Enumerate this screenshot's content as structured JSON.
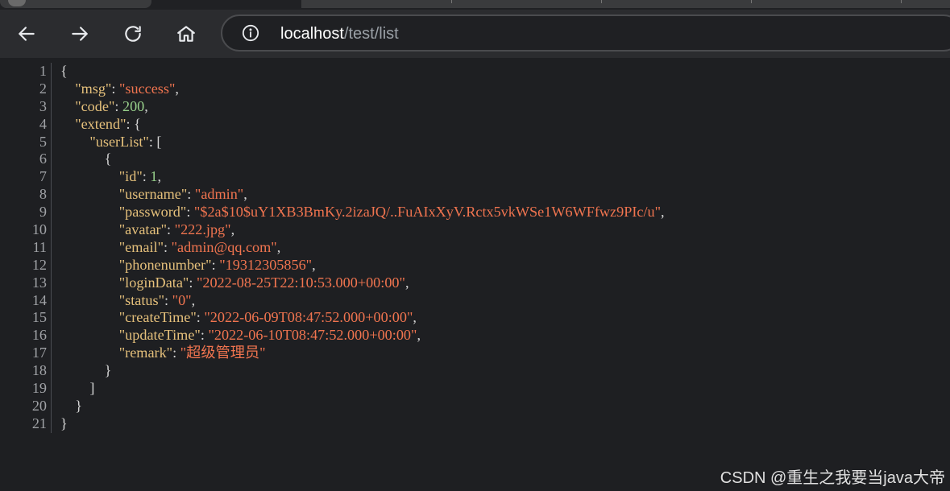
{
  "browser": {
    "url_host": "localhost",
    "url_path": "/test/list"
  },
  "json": {
    "msg_key": "\"msg\"",
    "msg_value": "\"success\"",
    "code_key": "\"code\"",
    "code_value": "200",
    "extend_key": "\"extend\"",
    "userList_key": "\"userList\"",
    "fields": [
      {
        "key": "\"id\"",
        "value": "1",
        "type": "number"
      },
      {
        "key": "\"username\"",
        "value": "\"admin\"",
        "type": "string"
      },
      {
        "key": "\"password\"",
        "value": "\"$2a$10$uY1XB3BmKy.2izaJQ/..FuAIxXyV.Rctx5vkWSe1W6WFfwz9PIc/u\"",
        "type": "string"
      },
      {
        "key": "\"avatar\"",
        "value": "\"222.jpg\"",
        "type": "string"
      },
      {
        "key": "\"email\"",
        "value": "\"admin@qq.com\"",
        "type": "string"
      },
      {
        "key": "\"phonenumber\"",
        "value": "\"19312305856\"",
        "type": "string"
      },
      {
        "key": "\"loginData\"",
        "value": "\"2022-08-25T22:10:53.000+00:00\"",
        "type": "string"
      },
      {
        "key": "\"status\"",
        "value": "\"0\"",
        "type": "string"
      },
      {
        "key": "\"createTime\"",
        "value": "\"2022-06-09T08:47:52.000+00:00\"",
        "type": "string"
      },
      {
        "key": "\"updateTime\"",
        "value": "\"2022-06-10T08:47:52.000+00:00\"",
        "type": "string"
      },
      {
        "key": "\"remark\"",
        "value": "\"超级管理员\"",
        "type": "string"
      }
    ]
  },
  "line_numbers": [
    "1",
    "2",
    "3",
    "4",
    "5",
    "6",
    "7",
    "8",
    "9",
    "10",
    "11",
    "12",
    "13",
    "14",
    "15",
    "16",
    "17",
    "18",
    "19",
    "20",
    "21"
  ],
  "watermark": "CSDN @重生之我要当java大帝",
  "icons": {
    "back": "arrow-left-icon",
    "forward": "arrow-right-icon",
    "reload": "reload-icon",
    "home": "home-icon",
    "info": "info-icon"
  },
  "colors": {
    "key": "#e5c07b",
    "string": "#f0744f",
    "number": "#98d08b",
    "punct": "#d4d4d4"
  }
}
